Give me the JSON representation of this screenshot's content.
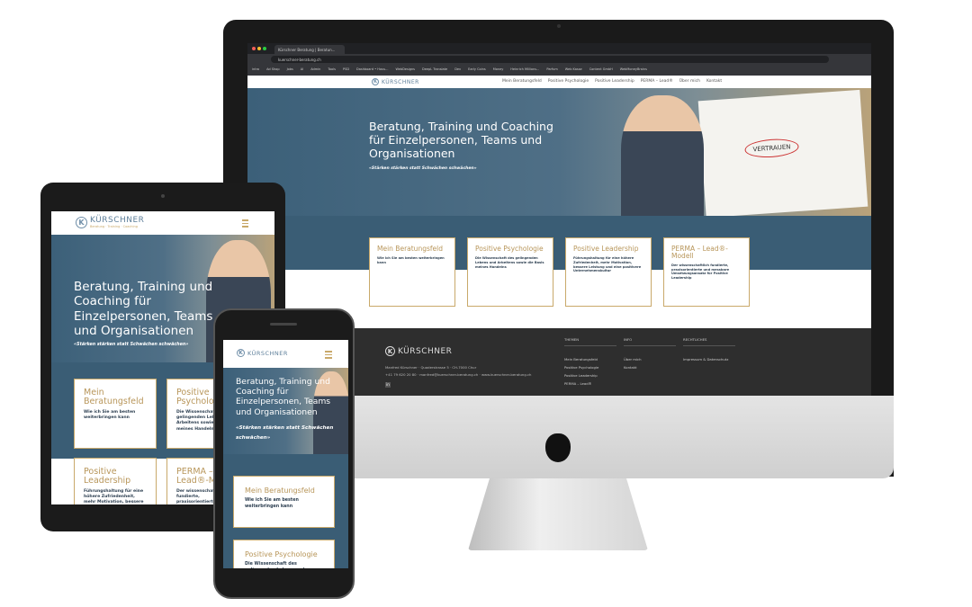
{
  "browser": {
    "tab_title": "Kürschner Beratung | Beratun...",
    "url": "kuerschner-beratung.ch",
    "bookmarks": [
      "intro",
      "Ad Shop",
      "Jobs",
      "AI",
      "Admin",
      "Tools",
      "PSD",
      "Dashboard • Haus...",
      "WebDesigns",
      "DeepL Translate",
      "Dev",
      "Early Coins",
      "Money",
      "Heinrich Millions...",
      "Parfum",
      "Web Kasse",
      "Content GmbH",
      "WebMoneyBrains"
    ]
  },
  "site": {
    "logo": {
      "name": "KÜRSCHNER",
      "tagline": "Beratung · Training · Coaching",
      "letter": "K"
    },
    "nav": [
      "Mein Beratungsfeld",
      "Positive Psychologie",
      "Positive Leadership",
      "PERMA – Lead®",
      "Über mich",
      "Kontakt"
    ],
    "hero": {
      "title": "Beratung, Training und Coaching für Einzelpersonen, Teams und Organisationen",
      "quote": "«Stärken stärken statt Schwächen schwächen»",
      "whiteboard": "VERTRAUEN"
    },
    "cards": [
      {
        "title": "Mein Beratungsfeld",
        "text": "Wie ich Sie am besten weiterbringen kann"
      },
      {
        "title": "Positive Psychologie",
        "text": "Die Wissenschaft des gelingenden Lebens und Arbeitens sowie die Basis meines Handelns"
      },
      {
        "title": "Positive Leadership",
        "text": "Führungshaltung für eine höhere Zufriedenheit, mehr Motivation, bessere Leistung und eine positivere Unternehmenskultur"
      },
      {
        "title": "PERMA – Lead®-Modell",
        "text": "Der wissenschaftlich fundierte, praxisorientierte und messbare Umsetzungsansatz für Positive Leadership"
      }
    ],
    "footer": {
      "address": "Manfred Kürschner · Quaderstrasse 5 · CH-7000 Chur",
      "contact": "+41 79 620 20 80 · manfred@kuerschner-beratung.ch · www.kuerschner-beratung.ch",
      "linkedin": "in",
      "columns": [
        {
          "head": "THEMEN",
          "links": [
            "Mein Beratungsfeld",
            "Positive Psychologie",
            "Positive Leadership",
            "PERMA – Lead®"
          ]
        },
        {
          "head": "INFO",
          "links": [
            "Über mich",
            "Kontakt"
          ]
        },
        {
          "head": "RECHTLICHES",
          "links": [
            "Impressum & Datenschutz"
          ]
        }
      ]
    }
  }
}
